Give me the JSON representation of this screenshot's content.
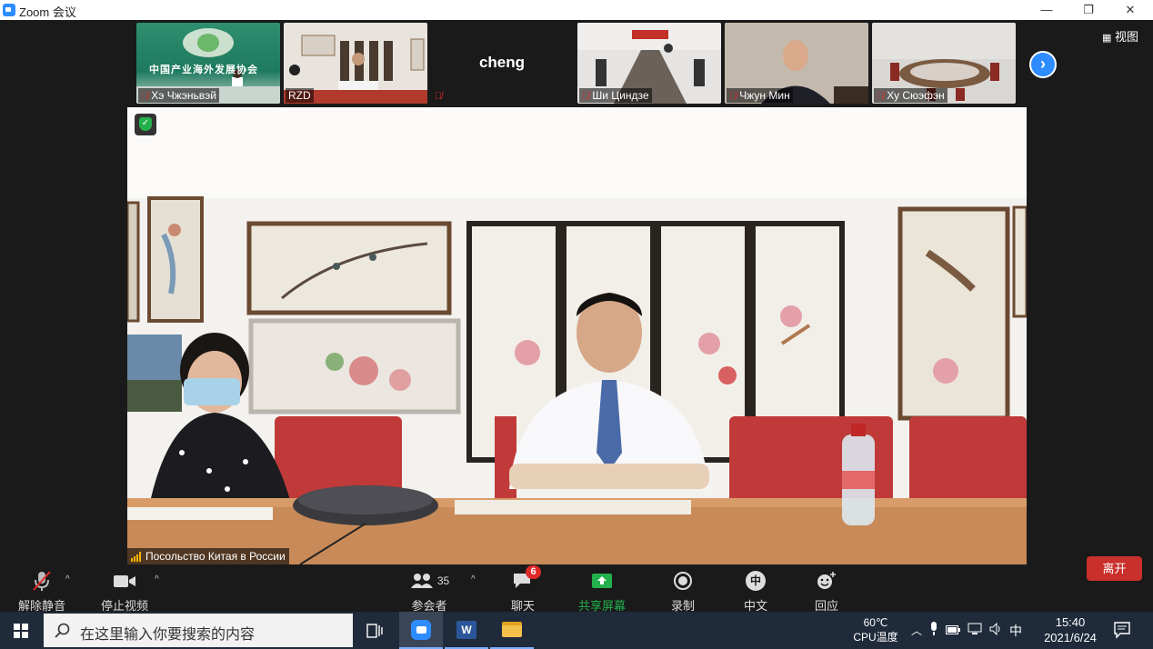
{
  "window": {
    "title": "Zoom 会议",
    "minimize_glyph": "—",
    "restore_glyph": "❐",
    "close_glyph": "✕"
  },
  "thumbnails": [
    {
      "name": "Хэ Чжэньвэй",
      "muted": true,
      "banner_text": "中国产业海外发展协会"
    },
    {
      "name": "RZD",
      "muted": false
    },
    {
      "name": "",
      "muted": true,
      "center_text": "cheng"
    },
    {
      "name": "Ши Циндзе",
      "muted": true
    },
    {
      "name": "Чжун Мин",
      "muted": true
    },
    {
      "name": "Ху Сюэфэн",
      "muted": true
    }
  ],
  "view_button": {
    "label": "视图",
    "icon": "grid-icon"
  },
  "next_icon": "chevron-right-icon",
  "speaker": {
    "name": "Посольство Китая в России"
  },
  "toolbar": {
    "unmute": {
      "label": "解除静音",
      "icon": "mic-muted-icon"
    },
    "stop_video": {
      "label": "停止视频",
      "icon": "video-camera-icon"
    },
    "participants": {
      "label": "参会者",
      "count": "35",
      "icon": "participants-icon"
    },
    "chat": {
      "label": "聊天",
      "badge": "6",
      "icon": "chat-icon"
    },
    "share": {
      "label": "共享屏幕",
      "icon": "share-screen-icon"
    },
    "record": {
      "label": "录制",
      "icon": "record-icon"
    },
    "language": {
      "label": "中文",
      "glyph": "中",
      "icon": "language-icon"
    },
    "reactions": {
      "label": "回应",
      "icon": "reaction-icon"
    },
    "leave": {
      "label": "离开"
    }
  },
  "taskbar": {
    "search_placeholder": "在这里输入你要搜索的内容",
    "cpu_temp": "60℃",
    "cpu_label": "CPU温度",
    "ime": "中",
    "time": "15:40",
    "date": "2021/6/24"
  },
  "colors": {
    "zoom_blue": "#2d8cff",
    "share_green": "#23b14d",
    "leave_red": "#c9302c",
    "chat_badge": "#e02828"
  }
}
